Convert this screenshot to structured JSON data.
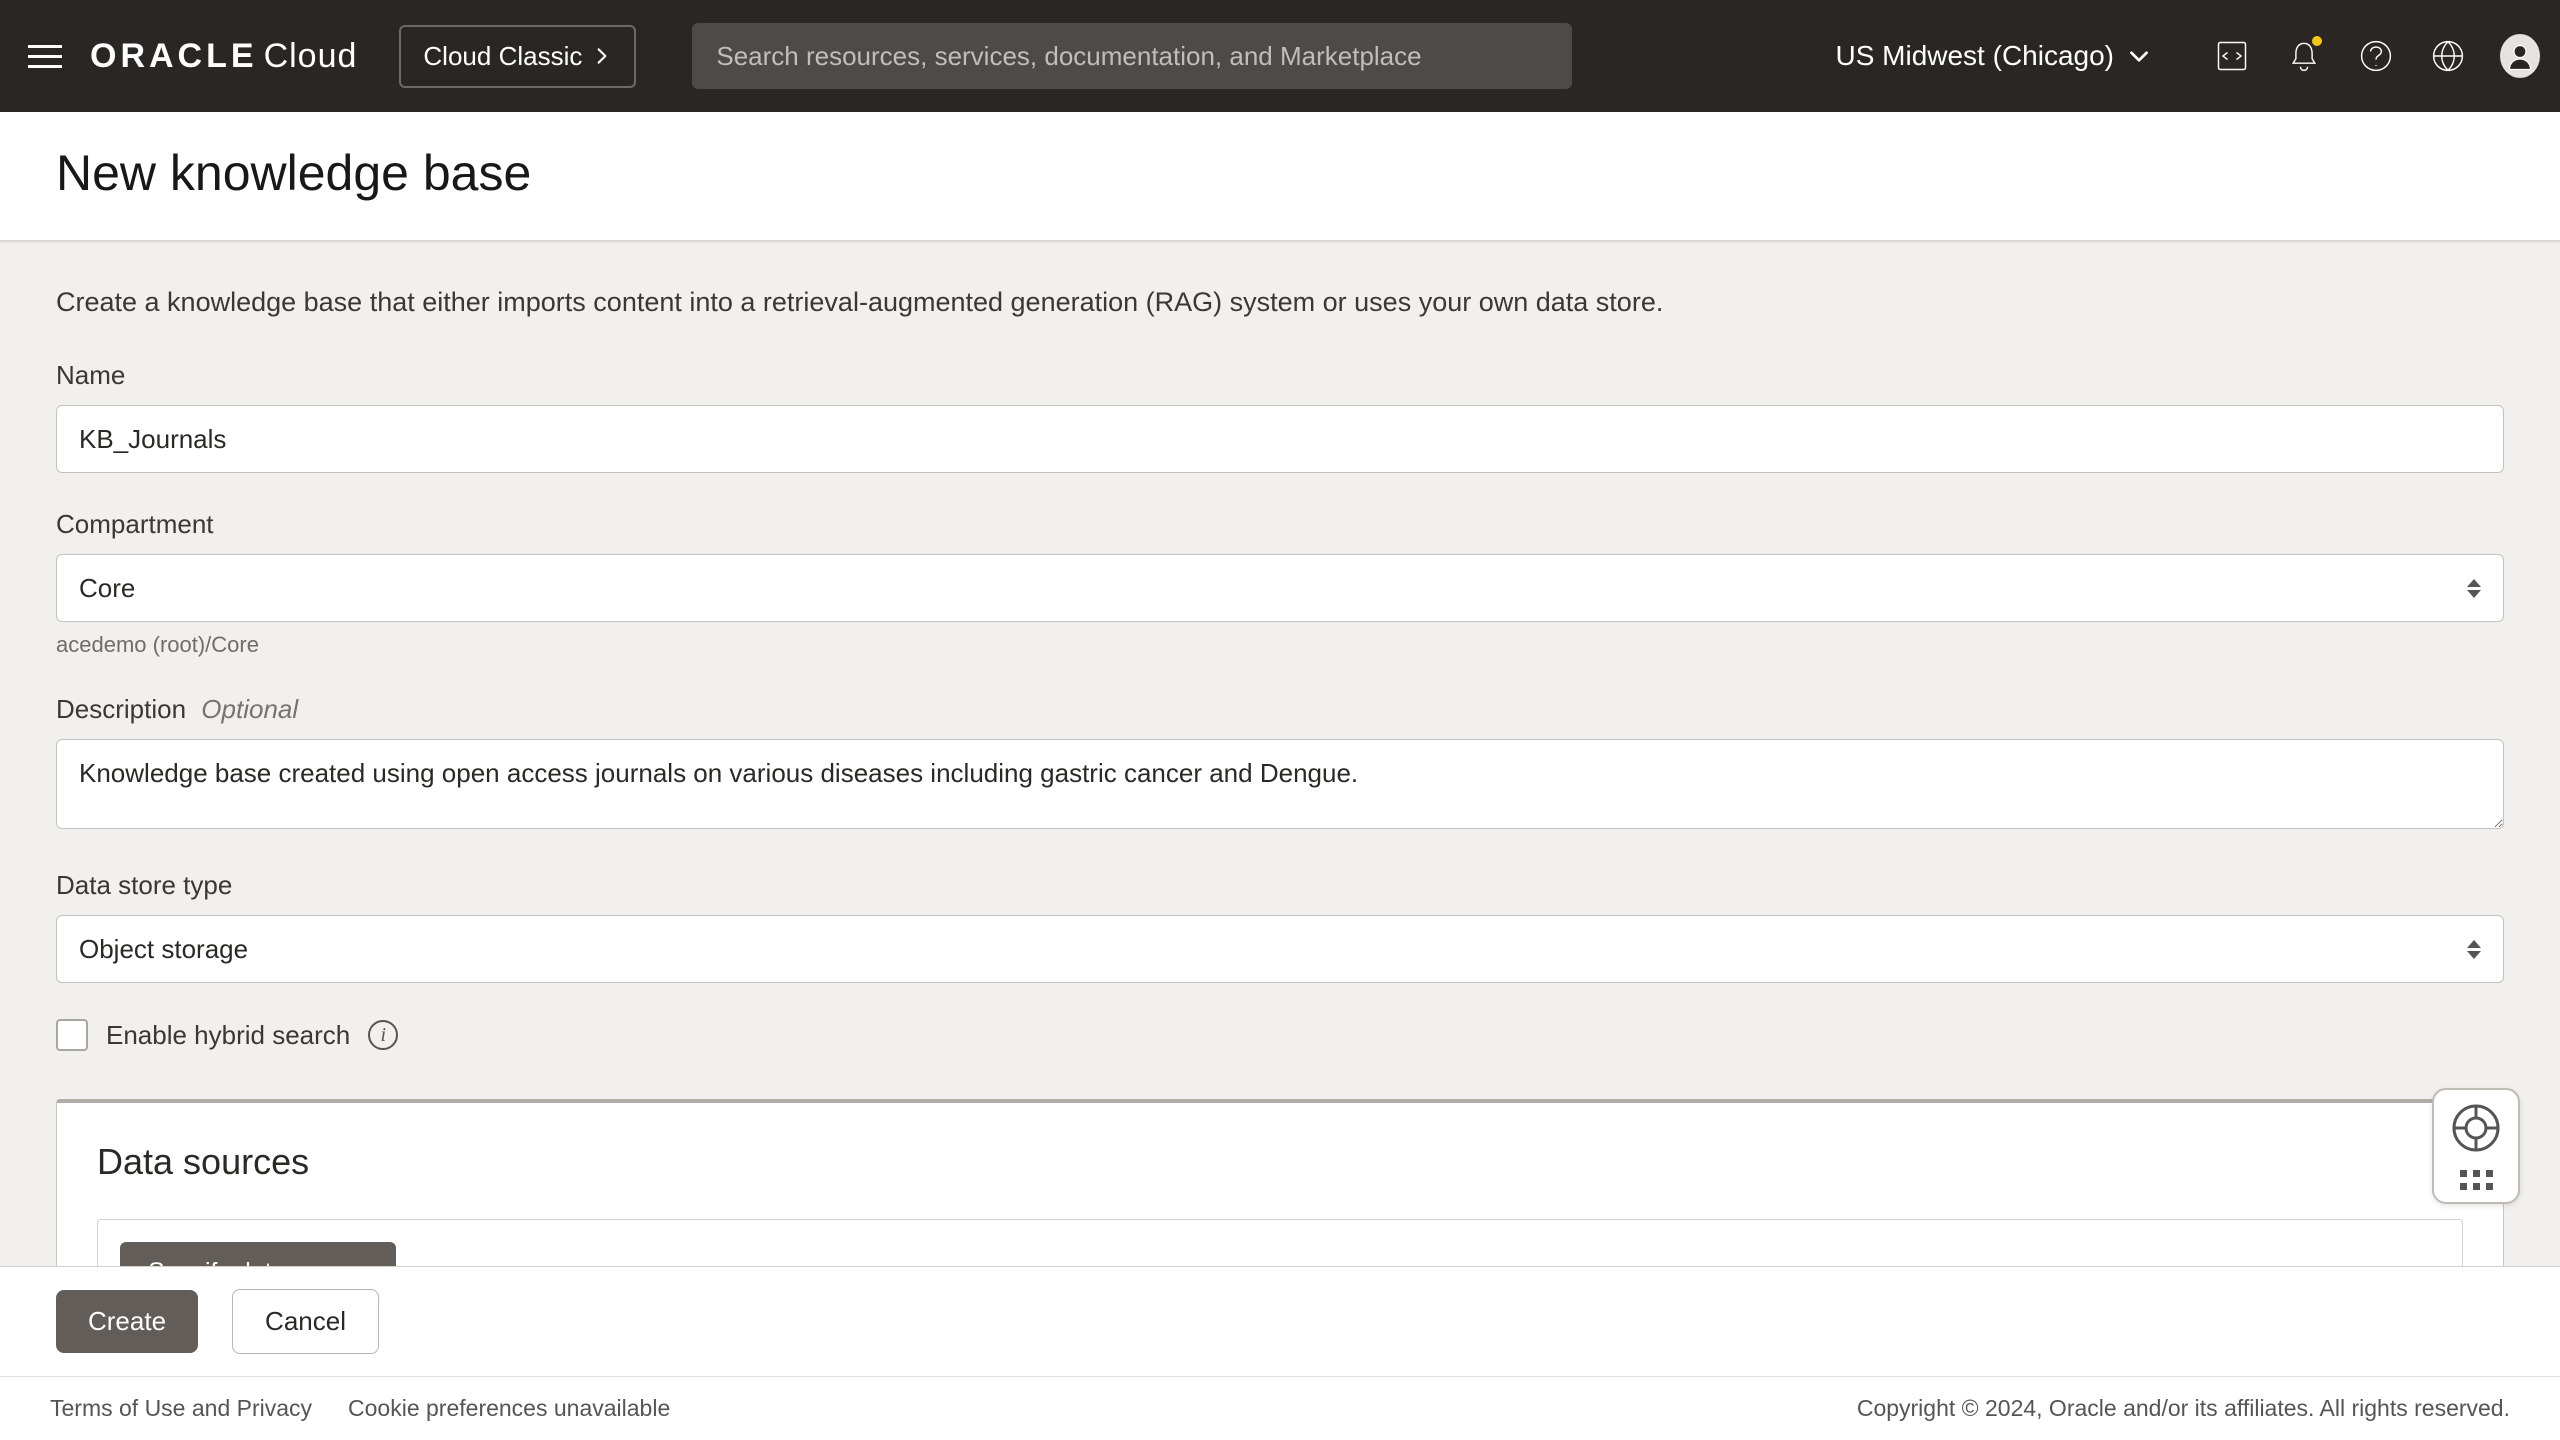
{
  "header": {
    "logo_brand": "ORACLE",
    "logo_suffix": "Cloud",
    "cloud_classic_label": "Cloud Classic",
    "search_placeholder": "Search resources, services, documentation, and Marketplace",
    "region": "US Midwest (Chicago)"
  },
  "page": {
    "title": "New knowledge base",
    "intro": "Create a knowledge base that either imports content into a retrieval-augmented generation (RAG) system or uses your own data store."
  },
  "form": {
    "name_label": "Name",
    "name_value": "KB_Journals",
    "compartment_label": "Compartment",
    "compartment_value": "Core",
    "compartment_path": "acedemo (root)/Core",
    "description_label": "Description",
    "description_optional": "Optional",
    "description_value": "Knowledge base created using open access journals on various diseases including gastric cancer and Dengue.",
    "data_store_type_label": "Data store type",
    "data_store_type_value": "Object storage",
    "enable_hybrid_label": "Enable hybrid search"
  },
  "data_sources": {
    "heading": "Data sources",
    "specify_button": "Specify data source"
  },
  "actions": {
    "create": "Create",
    "cancel": "Cancel"
  },
  "footer": {
    "terms": "Terms of Use and Privacy",
    "cookies": "Cookie preferences unavailable",
    "copyright": "Copyright © 2024, Oracle and/or its affiliates. All rights reserved."
  }
}
